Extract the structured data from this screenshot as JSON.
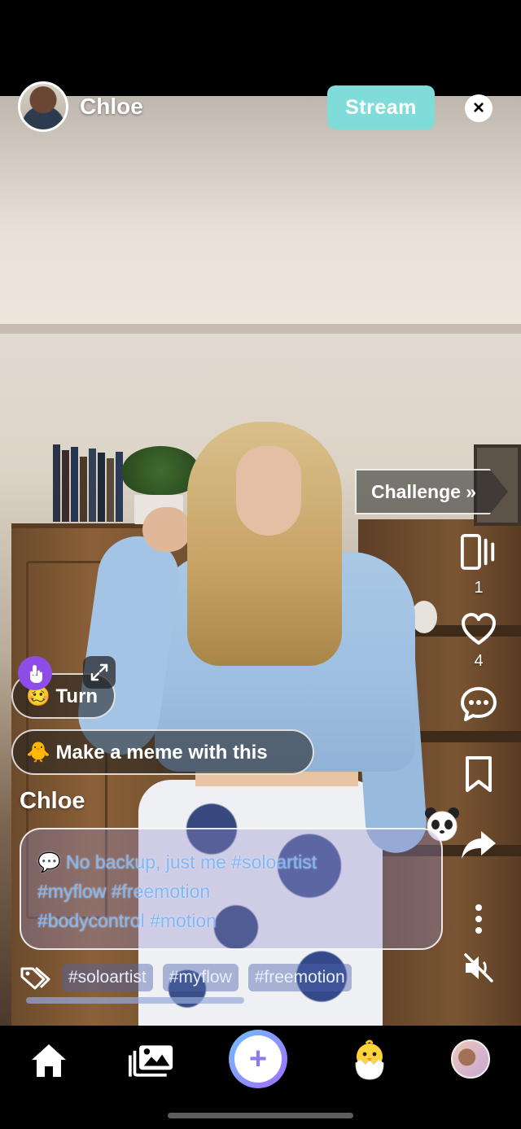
{
  "header": {
    "username": "Chloe",
    "stream_label": "Stream"
  },
  "right_rail": {
    "challenge_label": "Challenge »",
    "swipe_count": "1",
    "likes_count": "4"
  },
  "effects": {
    "turn_label": "🥴 Turn",
    "meme_label": "🐥 Make a meme with this"
  },
  "post": {
    "author": "Chloe",
    "caption_line1": "💬 No backup, just me #soloartist",
    "caption_line2": "#myflow #freemotion",
    "caption_line3": "#bodycontrol #motion",
    "tags": [
      "#soloartist",
      "#myflow",
      "#freemotion"
    ]
  },
  "bottom_nav": {
    "items": [
      "home-icon",
      "gallery-icon",
      "create-icon",
      "chick-icon",
      "profile-avatar"
    ]
  },
  "colors": {
    "stream_button": "#7fdcd9",
    "accent_purple": "#8e4de9",
    "caption_text": "#7fb8f6"
  }
}
